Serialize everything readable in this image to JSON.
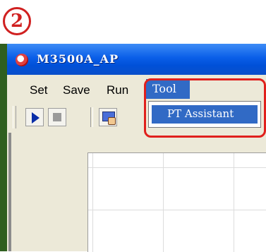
{
  "step_badge": "2",
  "window": {
    "title": "M3500A_AP",
    "icon": "app-logo-icon"
  },
  "menubar": {
    "items": [
      "Set",
      "Save",
      "Run",
      "Tool"
    ],
    "active": "Tool"
  },
  "dropdown": {
    "items": [
      "PT Assistant"
    ]
  },
  "toolbar": {
    "buttons": [
      "play-icon",
      "stop-icon",
      "pt-assistant-icon"
    ]
  },
  "colors": {
    "titlebar": "#0a5ee8",
    "menu_highlight": "#316ac5",
    "callout_red": "#e0201c"
  }
}
